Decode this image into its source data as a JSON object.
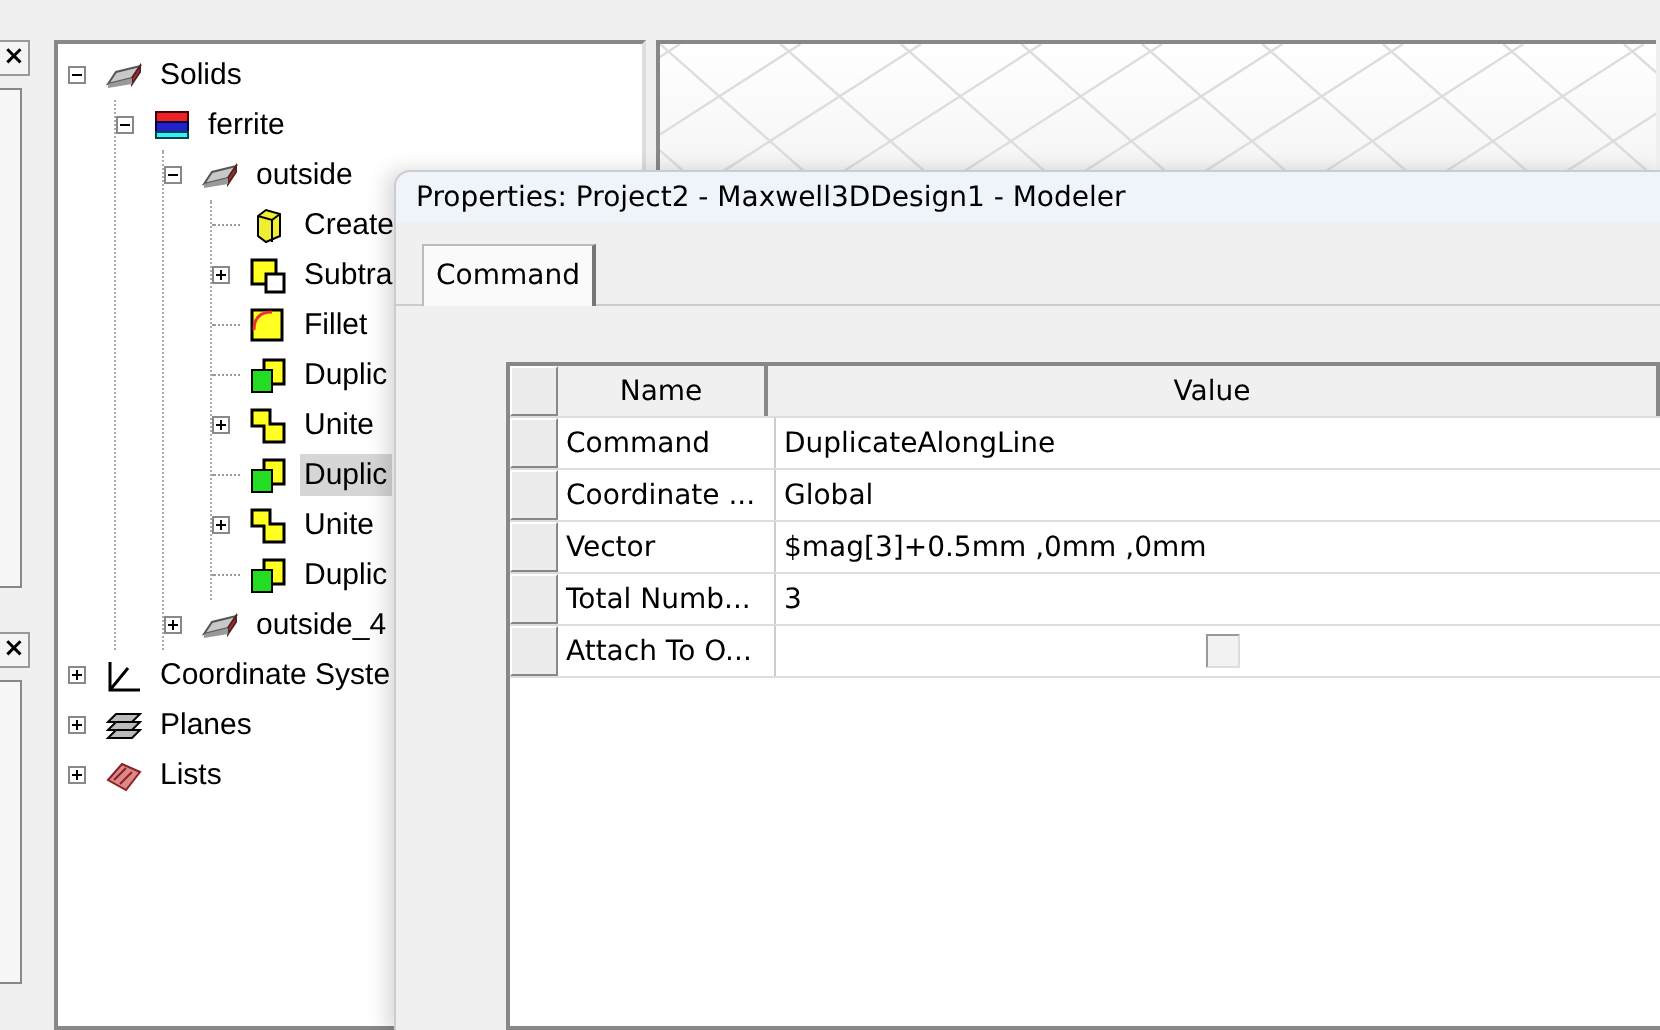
{
  "side_panels": [
    {
      "close": "×"
    },
    {
      "close": "×"
    }
  ],
  "tree": [
    {
      "label": "Solids",
      "kind": "solid",
      "expanded": true,
      "selected": false,
      "children": [
        {
          "label": "ferrite",
          "kind": "material",
          "expanded": true,
          "selected": false,
          "children": [
            {
              "label": "outside",
              "kind": "solid",
              "expanded": true,
              "selected": false,
              "children": [
                {
                  "label": "Create",
                  "kind": "box",
                  "selected": false
                },
                {
                  "label": "Subtra",
                  "kind": "subtract",
                  "expanded": false,
                  "selected": false
                },
                {
                  "label": "Fillet",
                  "kind": "fillet",
                  "selected": false
                },
                {
                  "label": "Duplic",
                  "kind": "duplicate",
                  "selected": false
                },
                {
                  "label": "Unite",
                  "kind": "unite",
                  "expanded": false,
                  "selected": false
                },
                {
                  "label": "Duplic",
                  "kind": "duplicate",
                  "selected": true
                },
                {
                  "label": "Unite",
                  "kind": "unite",
                  "expanded": false,
                  "selected": false
                },
                {
                  "label": "Duplic",
                  "kind": "duplicate",
                  "selected": false
                }
              ]
            },
            {
              "label": "outside_4",
              "kind": "solid",
              "expanded": false,
              "selected": false
            }
          ]
        }
      ]
    },
    {
      "label": "Coordinate Syste",
      "kind": "coordinates",
      "expanded": false,
      "selected": false
    },
    {
      "label": "Planes",
      "kind": "planes",
      "expanded": false,
      "selected": false
    },
    {
      "label": "Lists",
      "kind": "lists",
      "expanded": false,
      "selected": false
    }
  ],
  "dialog": {
    "title": "Properties: Project2 - Maxwell3DDesign1 - Modeler",
    "tabs": [
      {
        "label": "Command",
        "selected": true
      }
    ],
    "table": {
      "columns": [
        "Name",
        "Value"
      ],
      "rows": [
        {
          "name": "Command",
          "kind": "text",
          "value": "DuplicateAlongLine"
        },
        {
          "name": "Coordinate ...",
          "kind": "text",
          "value": "Global"
        },
        {
          "name": "Vector",
          "kind": "text",
          "value": "$mag[3]+0.5mm ,0mm ,0mm"
        },
        {
          "name": "Total Numb...",
          "kind": "text",
          "value": "3"
        },
        {
          "name": "Attach To O...",
          "kind": "checkbox",
          "checked": false
        }
      ]
    }
  }
}
